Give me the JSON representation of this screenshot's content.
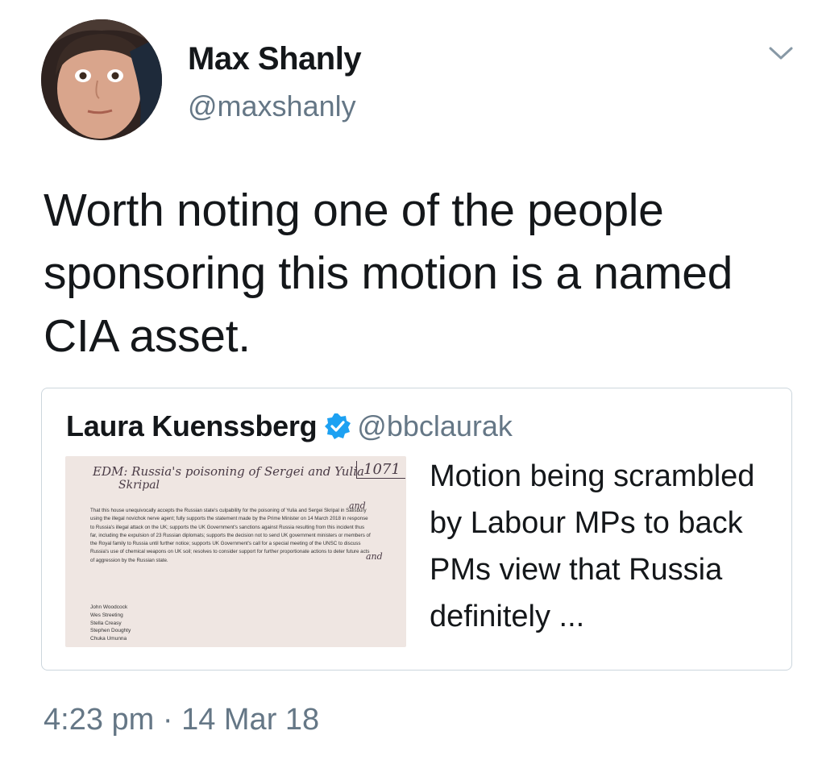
{
  "author": {
    "name": "Max Shanly",
    "handle": "@maxshanly"
  },
  "tweet": {
    "text": "Worth noting one of the people sponsoring this motion is a named CIA asset.",
    "timestamp": "4:23 pm · 14 Mar 18"
  },
  "icons": {
    "menu": "chevron-down-icon",
    "verified": "verified-badge-icon"
  },
  "colors": {
    "verified": "#1da1f2",
    "secondary_text": "#657786",
    "border": "#ccd6dd"
  },
  "quoted_tweet": {
    "name": "Laura Kuenssberg",
    "handle": "@bbclaurak",
    "text": "Motion being scrambled by Labour MPs to back PMs view that Russia definitely ...",
    "image": {
      "title_line1": "EDM: Russia's poisoning of Sergei and Yulia",
      "title_line2": "Skripal",
      "number": "1071",
      "body": "That this house unequivocally accepts the Russian state's culpability for the poisoning of Yulia and Sergei Skripal in Salisbury using the illegal novichok nerve agent; fully supports the statement made by the Prime Minister on 14 March 2018 in response to Russia's illegal attack on the UK; supports the UK Government's sanctions against Russia resulting from this incident thus far, including the expulsion of 23 Russian diplomats; supports the decision not to send UK government ministers or members of the Royal family to Russia until further notice; supports UK Government's call for a special meeting of the UNSC to discuss Russia's use of chemical weapons on UK soil; resolves to consider support for further proportionate actions to deter future acts of aggression by the Russian state.",
      "annotation1": "and",
      "annotation2": "and",
      "sponsors": [
        "John Woodcock",
        "Wes Streeting",
        "Stella Creasy",
        "Stephen Doughty",
        "Chuka Umunna"
      ]
    }
  }
}
